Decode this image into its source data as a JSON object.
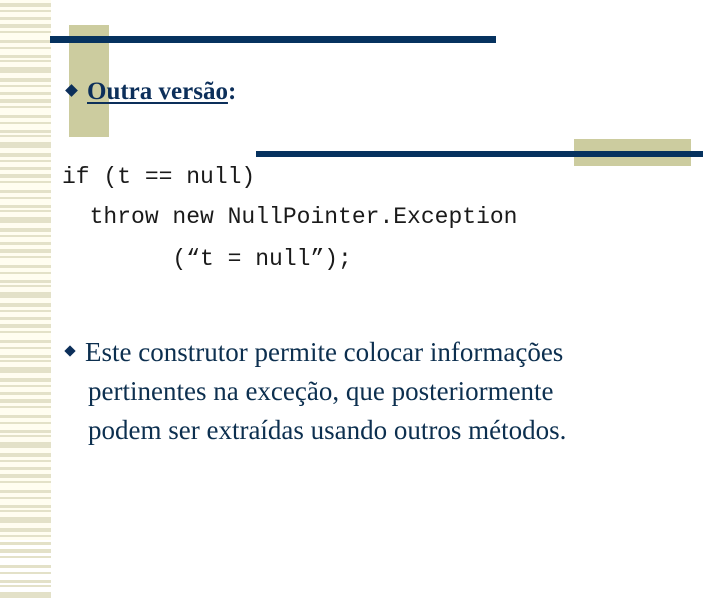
{
  "slide": {
    "title": "Outra versão",
    "title_suffix": ":",
    "code_lines": [
      "if (t == null)",
      "  throw new NullPointer.Exception",
      "        (“t = null”);"
    ],
    "body_bullet": {
      "lines": [
        "Este construtor permite colocar informações",
        "pertinentes na exceção, que posteriormente",
        "podem ser extraídas usando outros métodos."
      ]
    },
    "colors": {
      "navy": "#06325f",
      "tan": "#cccc9f",
      "stripe": "#e3e1c8",
      "cream": "#fffdf0"
    }
  }
}
